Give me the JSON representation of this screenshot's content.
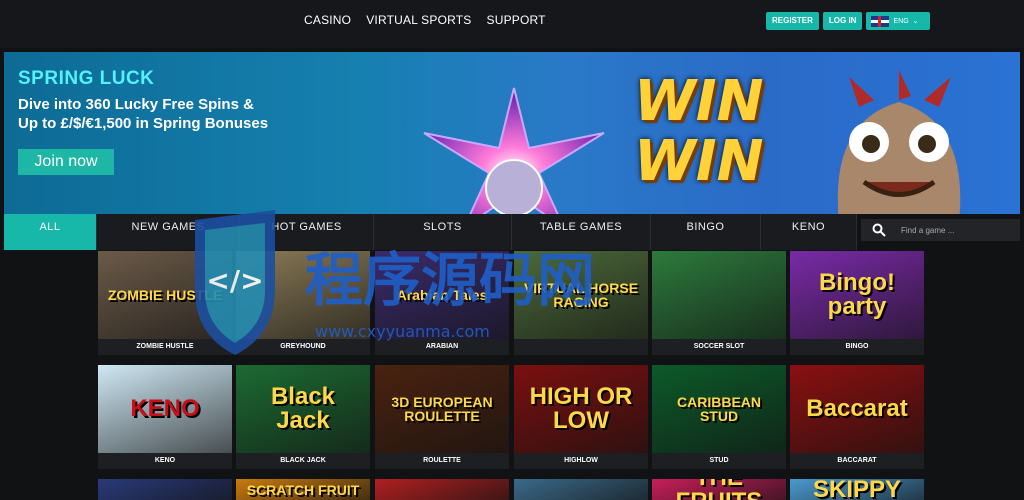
{
  "nav": {
    "items": [
      "CASINO",
      "VIRTUAL SPORTS",
      "SUPPORT"
    ]
  },
  "auth": {
    "register": "REGISTER",
    "login": "LOG IN",
    "lang": "ENG"
  },
  "banner": {
    "headline": "SPRING LUCK",
    "line1": "Dive into 360 Lucky Free Spins &",
    "line2": "Up to £/$/€1,500 in Spring Bonuses",
    "cta": "Join now",
    "win1": "WIN",
    "win2": "WIN"
  },
  "tabs": [
    "ALL",
    "NEW GAMES",
    "HOT GAMES",
    "SLOTS",
    "TABLE GAMES",
    "BINGO",
    "KENO"
  ],
  "search": {
    "placeholder": "Find a game ..."
  },
  "watermark": {
    "cn": "程序源码网",
    "url": "www.cxyyuanma.com"
  },
  "games": [
    {
      "name": "ZOMBIE HUSTLE",
      "art": "ZOMBIE HUSTLE",
      "bg": "#6b5a48"
    },
    {
      "name": "GREYHOUND",
      "art": "",
      "bg": "#8a7a56"
    },
    {
      "name": "ARABIAN",
      "art": "Arabian Tales",
      "bg": "#3a2a6a"
    },
    {
      "name": "",
      "art": "VIRTUAL HORSE RACING",
      "bg": "#4c6a3a"
    },
    {
      "name": "SOCCER SLOT",
      "art": "",
      "bg": "#2c7a3c"
    },
    {
      "name": "BINGO",
      "art": "Bingo! party",
      "bg": "#7a2aa8"
    },
    {
      "name": "KENO",
      "art": "KENO",
      "bg": "#cfe8f4"
    },
    {
      "name": "BLACK JACK",
      "art": "Black Jack",
      "bg": "#1c6a32"
    },
    {
      "name": "ROULETTE",
      "art": "3D EUROPEAN ROULETTE",
      "bg": "#4a2210"
    },
    {
      "name": "HIGHLOW",
      "art": "HIGH OR LOW",
      "bg": "#7a1010"
    },
    {
      "name": "STUD",
      "art": "CARIBBEAN STUD",
      "bg": "#0c5a2a"
    },
    {
      "name": "BACCARAT",
      "art": "Baccarat",
      "bg": "#8a1010"
    },
    {
      "name": "",
      "art": "",
      "bg": "#2a3a7a"
    },
    {
      "name": "",
      "art": "SCRATCH FRUIT",
      "bg": "#c87a10"
    },
    {
      "name": "",
      "art": "",
      "bg": "#b02020"
    },
    {
      "name": "",
      "art": "",
      "bg": "#3a6a8a"
    },
    {
      "name": "",
      "art": "THE FRUITS",
      "bg": "#c81e5a"
    },
    {
      "name": "",
      "art": "SKIPPY",
      "bg": "#4a9ad0"
    }
  ],
  "colors": {
    "accent": "#17b7a9",
    "bg": "#111214"
  }
}
